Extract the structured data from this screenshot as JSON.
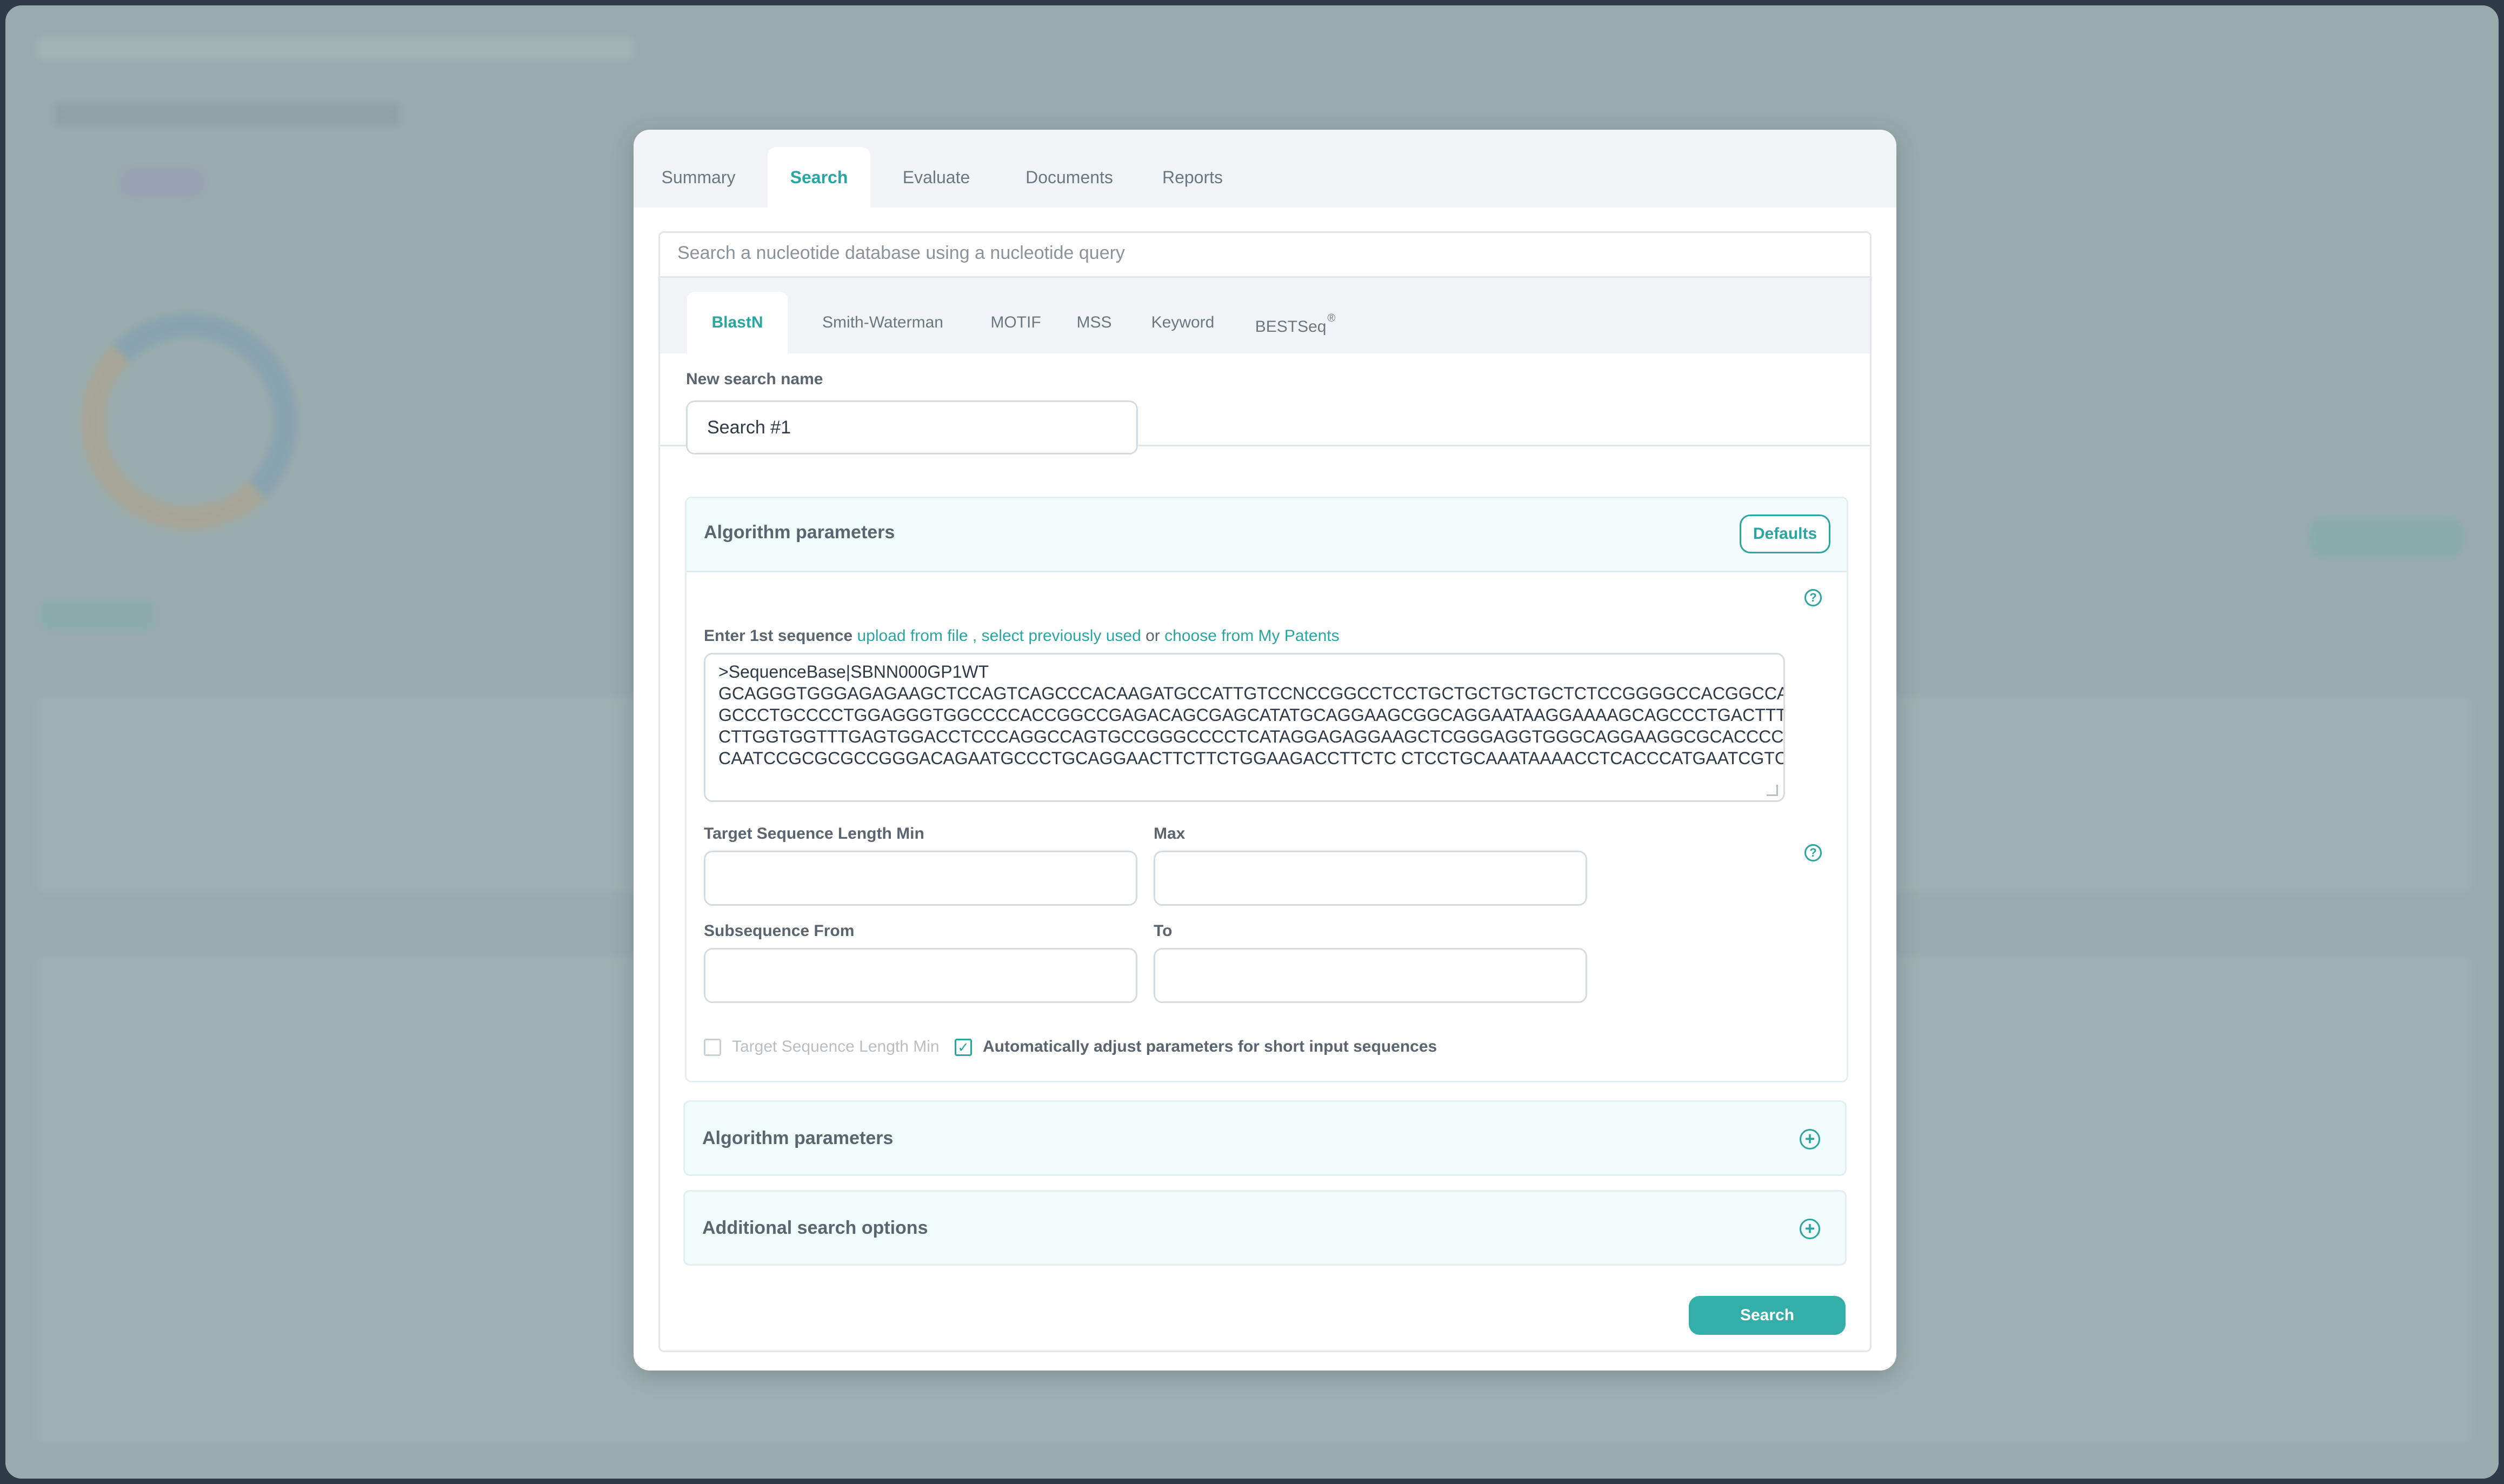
{
  "modal": {
    "tabs": [
      {
        "label": "Summary"
      },
      {
        "label": "Search"
      },
      {
        "label": "Evaluate"
      },
      {
        "label": "Documents"
      },
      {
        "label": "Reports"
      }
    ],
    "active_tab": "Search"
  },
  "panel": {
    "title": "Search a nucleotide database using a nucleotide query",
    "subtabs": [
      {
        "label": "BlastN"
      },
      {
        "label": "Smith-Waterman"
      },
      {
        "label": "MOTIF"
      },
      {
        "label": "MSS"
      },
      {
        "label": "Keyword"
      },
      {
        "label": "BESTSeq",
        "sup": "®"
      }
    ],
    "active_subtab": "BlastN"
  },
  "search_name": {
    "label": "New search name",
    "value": "Search #1"
  },
  "algorithm": {
    "title": "Algorithm parameters",
    "defaults_label": "Defaults",
    "seq_label": "Enter 1st sequence",
    "link_upload": "upload from file",
    "separator": ",",
    "link_previous": "select previously used",
    "or_text": "or",
    "link_patents": "choose from My Patents",
    "sequence_lines": [
      ">SequenceBase|SBNN000GP1WT",
      "GCAGGGTGGGAGAGAAGCTCCAGTCAGCCCACAAGATGCCATTGTCCNCCGGCCTCCTGCTGCTGCTGCTCTCCGGGGCCACGGCCACCGCT",
      "GCCCTGCCCCTGGAGGGTGGCCCCACCGGCCGAGACAGCGAGCATATGCAGGAAGCGGCAGGAATAAGGAAAAGCAGCCCTGACTTTCCTCG",
      "CTTGGTGGTTTGAGTGGACCTCCCAGGCCAGTGCCGGGCCCCTCATAGGAGAGGAAGCTCGGGAGGTGGGCAGGAAGGCGCACCCCCCCAG",
      "CAATCCGCGCGCCGGGACAGAATGCCCTGCAGGAACTTCTTCTGGAAGACCTTCTC CTCCTGCAAATAAAACCTCACCCATGAATCGTCACG..."
    ],
    "target_min_label": "Target Sequence Length Min",
    "target_min_value": "",
    "max_label": "Max",
    "max_value": "",
    "subseq_from_label": "Subsequence From",
    "subseq_from_value": "",
    "to_label": "To",
    "to_value": "",
    "checkbox1_label": "Target Sequence Length Min",
    "checkbox1_checked": false,
    "checkbox2_label": "Automatically adjust parameters for short input sequences",
    "checkbox2_checked": true,
    "check_glyph": "✓"
  },
  "collapsed_sections": [
    {
      "title": "Algorithm parameters"
    },
    {
      "title": "Additional search options"
    }
  ],
  "help_glyph": "?",
  "plus_glyph": "+",
  "search_button": "Search",
  "colors": {
    "accent": "#2aa6a0",
    "button": "#33aea8",
    "frame": "#2e3a47"
  }
}
